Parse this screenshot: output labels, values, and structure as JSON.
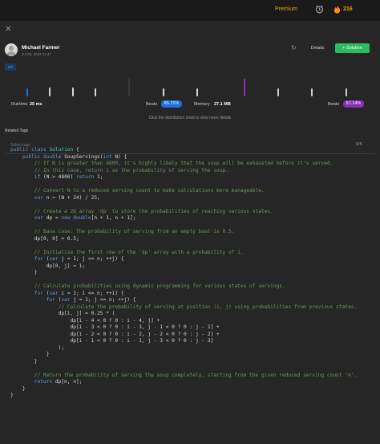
{
  "header": {
    "premium_label": "Premium",
    "streak_count": "216",
    "icons": [
      "alarm-clock-icon",
      "fire-icon"
    ],
    "accent_color": "#f0a000"
  },
  "post": {
    "author": "Michael Farmer",
    "date": "Jul 29, 2023 12:47",
    "details_label": "Details",
    "solution_label": "+ Solution",
    "language_tag": "C#"
  },
  "stats": {
    "runtime_label": "Runtime",
    "runtime_value": "25 ms",
    "runtime_beats_label": "Beats",
    "runtime_beats_value": "85.71%",
    "memory_label": "Memory",
    "memory_value": "27.1 MB",
    "memory_beats_label": "Beats",
    "memory_beats_value": "57.14%",
    "hint": "Click the distribution chart to view more details",
    "runtime_color": "#1f6fe0",
    "memory_color": "#8a2fb8"
  },
  "related_tags": {
    "title": "Related Tags",
    "placeholder": "Select tags",
    "count": "0/5"
  },
  "code_lines": [
    [
      [
        "kw",
        "public class "
      ],
      [
        "cls",
        "Solution"
      ],
      [
        "tx",
        " {"
      ]
    ],
    [
      [
        "kw",
        "    public double "
      ],
      [
        "tx",
        "SoupServings("
      ],
      [
        "kw",
        "int"
      ],
      [
        "tx",
        " N) {"
      ]
    ],
    [
      [
        "cm",
        "        // If N is greater than 4800, it's highly likely that the soup will be exhausted before it's served."
      ]
    ],
    [
      [
        "cm",
        "        // In this case, return 1 as the probability of serving the soup."
      ]
    ],
    [
      [
        "kw",
        "        if"
      ],
      [
        "tx",
        " (N > 4800) "
      ],
      [
        "kw",
        "return"
      ],
      [
        "tx",
        " 1;"
      ]
    ],
    [
      [
        "tx",
        ""
      ]
    ],
    [
      [
        "cm",
        "        // Convert N to a reduced serving count to make calculations more manageable."
      ]
    ],
    [
      [
        "kw",
        "        var"
      ],
      [
        "tx",
        " n = (N + 24) / 25;"
      ]
    ],
    [
      [
        "tx",
        ""
      ]
    ],
    [
      [
        "cm",
        "        // Create a 2D array 'dp' to store the probabilities of reaching various states."
      ]
    ],
    [
      [
        "kw",
        "        var"
      ],
      [
        "tx",
        " dp = "
      ],
      [
        "kw",
        "new double"
      ],
      [
        "tx",
        "[n + 1, n + 1];"
      ]
    ],
    [
      [
        "tx",
        ""
      ]
    ],
    [
      [
        "cm",
        "        // Base case: The probability of serving from an empty bowl is 0.5."
      ]
    ],
    [
      [
        "tx",
        "        dp[0, 0] = 0.5;"
      ]
    ],
    [
      [
        "tx",
        ""
      ]
    ],
    [
      [
        "cm",
        "        // Initialize the first row of the 'dp' array with a probability of 1."
      ]
    ],
    [
      [
        "kw",
        "        for"
      ],
      [
        "tx",
        " ("
      ],
      [
        "kw",
        "var"
      ],
      [
        "tx",
        " j = 1; j <= n; ++j) {"
      ]
    ],
    [
      [
        "tx",
        "            dp[0, j] = 1;"
      ]
    ],
    [
      [
        "tx",
        "        }"
      ]
    ],
    [
      [
        "tx",
        ""
      ]
    ],
    [
      [
        "cm",
        "        // Calculate probabilities using dynamic programming for various states of servings."
      ]
    ],
    [
      [
        "kw",
        "        for"
      ],
      [
        "tx",
        " ("
      ],
      [
        "kw",
        "var"
      ],
      [
        "tx",
        " i = 1; i <= n; ++i) {"
      ]
    ],
    [
      [
        "kw",
        "            for"
      ],
      [
        "tx",
        " ("
      ],
      [
        "kw",
        "var"
      ],
      [
        "tx",
        " j = 1; j <= n; ++j) {"
      ]
    ],
    [
      [
        "cm",
        "                // Calculate the probability of serving at position (i, j) using probabilities from previous states."
      ]
    ],
    [
      [
        "tx",
        "                dp[i, j] = 0.25 * ("
      ]
    ],
    [
      [
        "tx",
        "                    dp[i - 4 < 0 ? 0 : i - 4, j] +"
      ]
    ],
    [
      [
        "tx",
        "                    dp[i - 3 < 0 ? 0 : i - 3, j - 1 < 0 ? 0 : j - 1] +"
      ]
    ],
    [
      [
        "tx",
        "                    dp[i - 2 < 0 ? 0 : i - 2, j - 2 < 0 ? 0 : j - 2] +"
      ]
    ],
    [
      [
        "tx",
        "                    dp[i - 1 < 0 ? 0 : i - 1, j - 3 < 0 ? 0 : j - 3]"
      ]
    ],
    [
      [
        "tx",
        "                );"
      ]
    ],
    [
      [
        "tx",
        "            }"
      ]
    ],
    [
      [
        "tx",
        "        }"
      ]
    ],
    [
      [
        "tx",
        ""
      ]
    ],
    [
      [
        "cm",
        "        // Return the probability of serving the soup completely, starting from the given reduced serving count 'n'."
      ]
    ],
    [
      [
        "kw",
        "        return"
      ],
      [
        "tx",
        " dp[n, n];"
      ]
    ],
    [
      [
        "tx",
        "    }"
      ]
    ],
    [
      [
        "tx",
        "}"
      ]
    ]
  ]
}
